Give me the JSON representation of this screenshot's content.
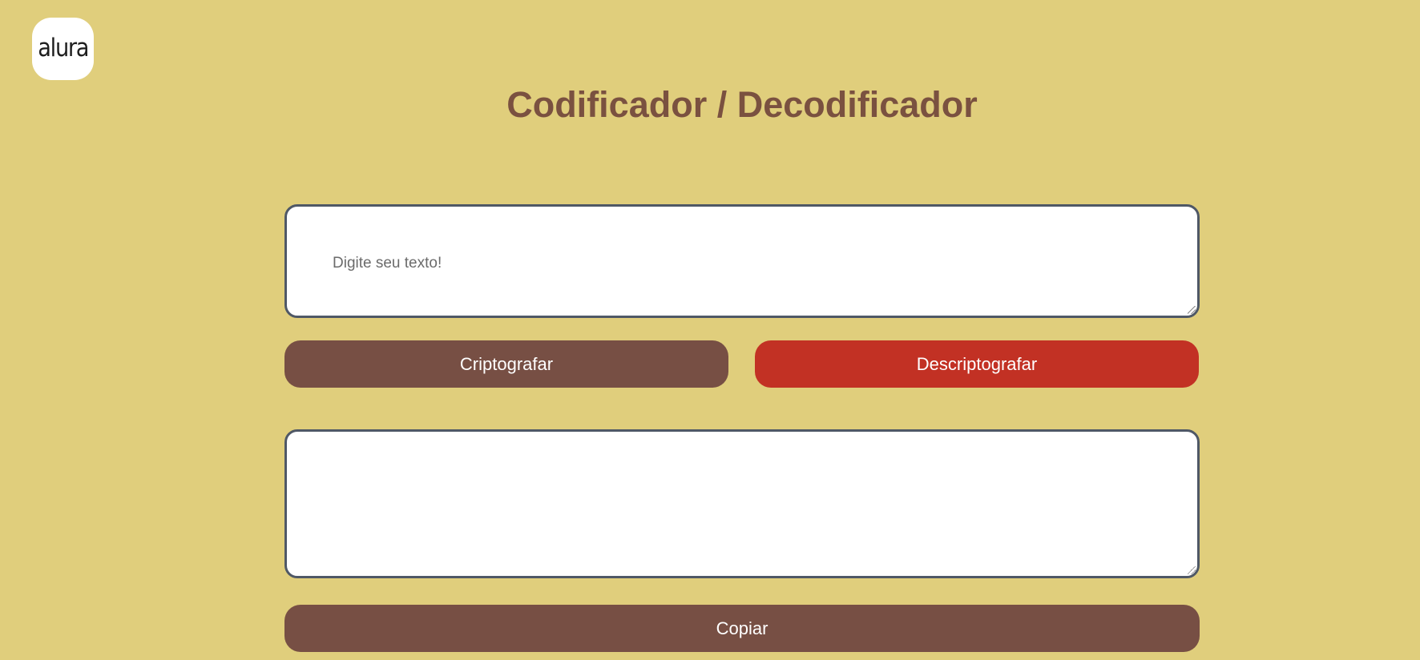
{
  "logo": {
    "text": "alura"
  },
  "page": {
    "title": "Codificador / Decodificador"
  },
  "input": {
    "value": "",
    "placeholder": "Digite seu texto!"
  },
  "output": {
    "value": ""
  },
  "buttons": {
    "encrypt": "Criptografar",
    "decrypt": "Descriptografar",
    "copy": "Copiar"
  },
  "colors": {
    "background": "#e0ce7c",
    "title": "#7a5140",
    "primary_button": "#774f44",
    "danger_button": "#c23124",
    "textarea_border": "#4f5866"
  }
}
